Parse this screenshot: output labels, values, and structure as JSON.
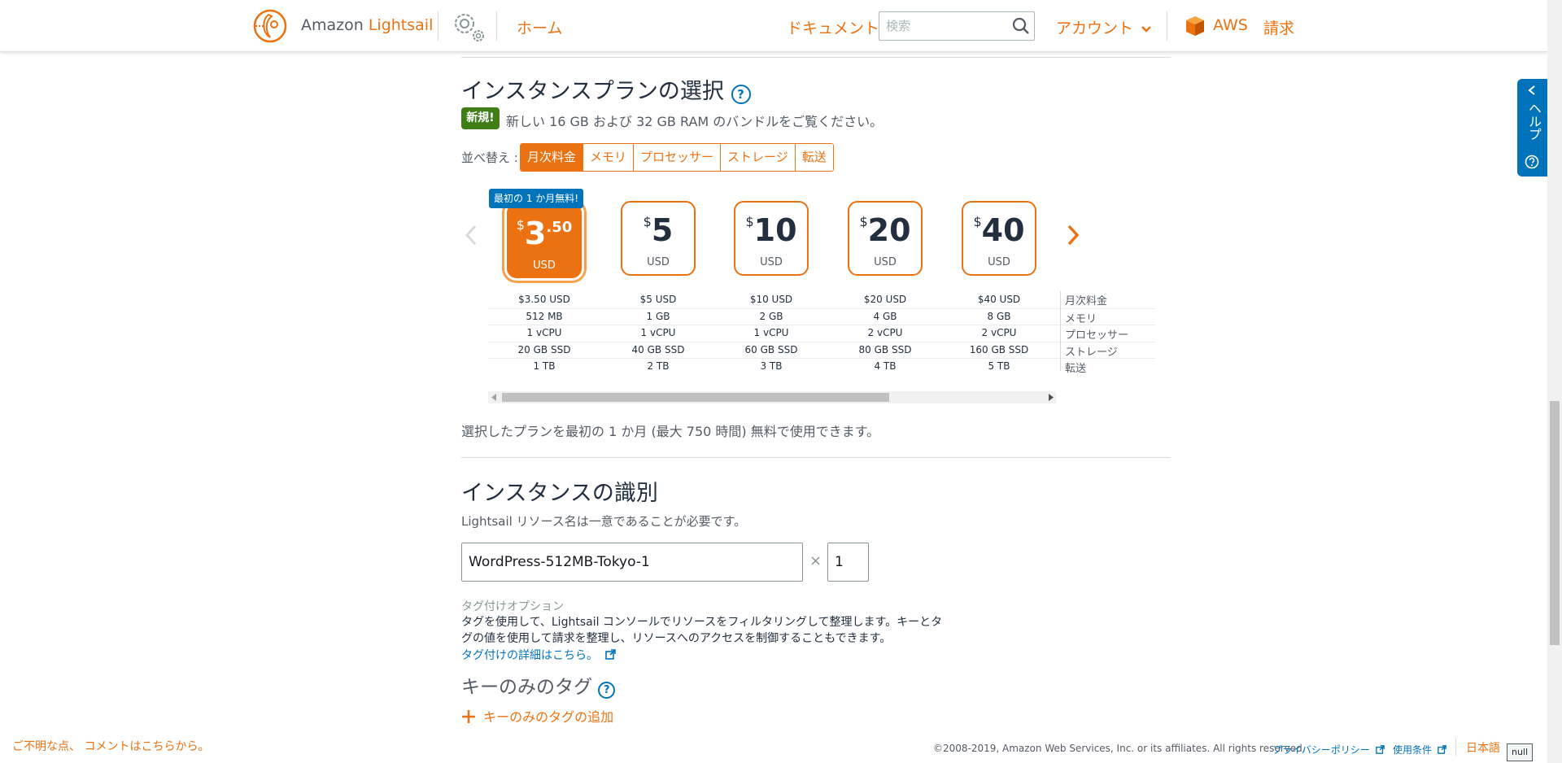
{
  "nav": {
    "brand_prefix": "Amazon",
    "brand_suffix": "Lightsail",
    "home": "ホーム",
    "docs": "ドキュメント",
    "search_placeholder": "検索",
    "account": "アカウント",
    "aws": "AWS",
    "billing": "請求"
  },
  "plan_section": {
    "title": "インスタンスプランの選択",
    "help": "?",
    "new_badge": "新規!",
    "new_text": "新しい 16 GB および 32 GB RAM のバンドルをご覧ください。",
    "sort_label": "並べ替え :",
    "sort_options": [
      "月次料金",
      "メモリ",
      "プロセッサー",
      "ストレージ",
      "転送"
    ],
    "promo": "最初の 1 か月無料!",
    "plans": [
      {
        "currency": "$",
        "amount": "3",
        "cents": ".50",
        "unit": "USD",
        "price": "$3.50 USD",
        "memory": "512 MB",
        "cpu": "1 vCPU",
        "storage": "20 GB SSD",
        "transfer": "1 TB"
      },
      {
        "currency": "$",
        "amount": "5",
        "cents": "",
        "unit": "USD",
        "price": "$5 USD",
        "memory": "1 GB",
        "cpu": "1 vCPU",
        "storage": "40 GB SSD",
        "transfer": "2 TB"
      },
      {
        "currency": "$",
        "amount": "10",
        "cents": "",
        "unit": "USD",
        "price": "$10 USD",
        "memory": "2 GB",
        "cpu": "1 vCPU",
        "storage": "60 GB SSD",
        "transfer": "3 TB"
      },
      {
        "currency": "$",
        "amount": "20",
        "cents": "",
        "unit": "USD",
        "price": "$20 USD",
        "memory": "4 GB",
        "cpu": "2 vCPU",
        "storage": "80 GB SSD",
        "transfer": "4 TB"
      },
      {
        "currency": "$",
        "amount": "40",
        "cents": "",
        "unit": "USD",
        "price": "$40 USD",
        "memory": "8 GB",
        "cpu": "2 vCPU",
        "storage": "160 GB SSD",
        "transfer": "5 TB"
      }
    ],
    "spec_labels": [
      "月次料金",
      "メモリ",
      "プロセッサー",
      "ストレージ",
      "転送"
    ],
    "free_note": "選択したプランを最初の 1 か月 (最大 750 時間) 無料で使用できます。"
  },
  "identify": {
    "title": "インスタンスの識別",
    "desc": "Lightsail リソース名は一意であることが必要です。",
    "name_value": "WordPress-512MB-Tokyo-1",
    "times": "×",
    "count_value": "1"
  },
  "tags": {
    "option_label": "タグ付けオプション",
    "desc_line1": "タグを使用して、Lightsail コンソールでリソースをフィルタリングして整理します。キーとタ",
    "desc_line2": "グの値を使用して請求を整理し、リソースへのアクセスを制御することもできます。",
    "details_link": "タグ付けの詳細はこちら。",
    "key_only_title": "キーのみのタグ",
    "add_key_only": "キーのみのタグの追加"
  },
  "help_tab": {
    "label": "ヘルプ"
  },
  "footer": {
    "feedback": "ご不明な点、 コメントはこちらから。",
    "copyright": "©2008-2019, Amazon Web Services, Inc. or its affiliates. All rights reserved.",
    "privacy": "プライバシーポリシー",
    "terms": "使用条件",
    "language": "日本語",
    "null_badge": "null"
  },
  "colors": {
    "accent": "#ec7211",
    "link": "#0073bb",
    "new_badge": "#3f7e17",
    "text": "#232f3e"
  }
}
